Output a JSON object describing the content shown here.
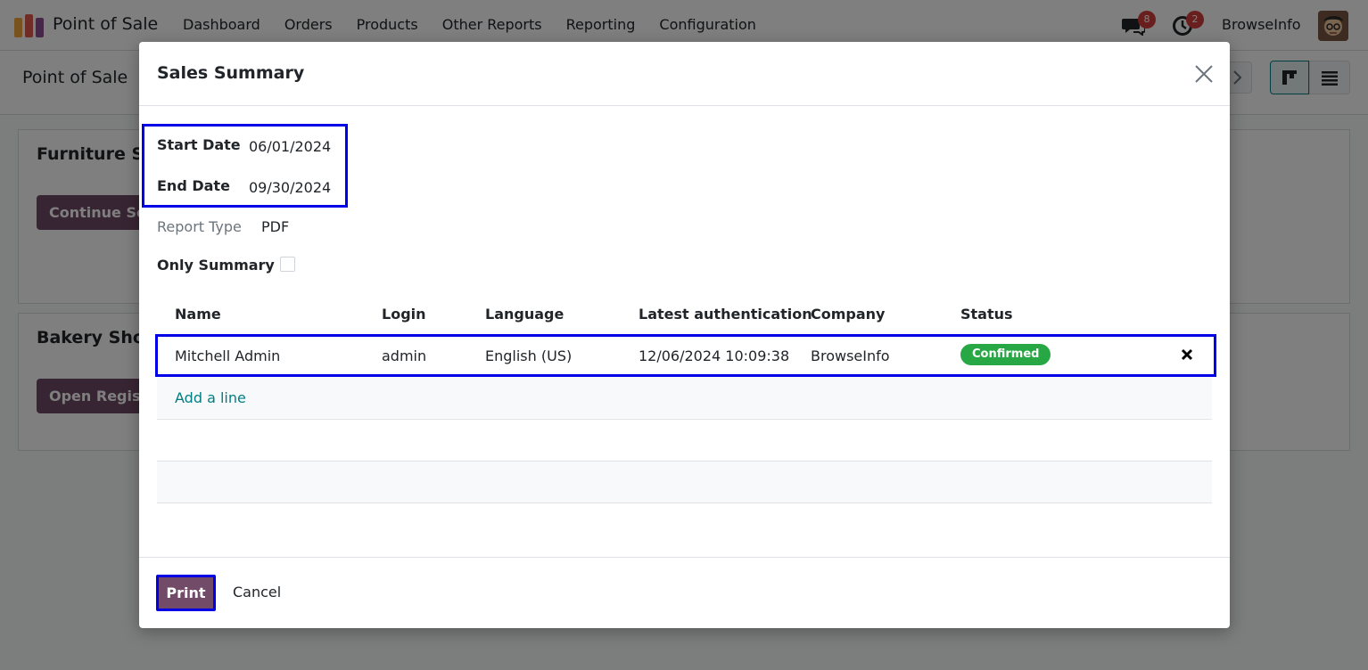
{
  "navbar": {
    "app_name": "Point of Sale",
    "menu": [
      "Dashboard",
      "Orders",
      "Products",
      "Other Reports",
      "Reporting",
      "Configuration"
    ],
    "messages_count": "8",
    "activities_count": "2",
    "user_name": "BrowseInfo"
  },
  "control_panel": {
    "breadcrumb": "Point of Sale"
  },
  "kanban": {
    "cards": [
      {
        "title": "Furniture Sh",
        "button": "Continue Se"
      },
      {
        "title": "Bakery Shop",
        "button": "Open Regist"
      }
    ]
  },
  "modal": {
    "title": "Sales Summary",
    "start_date_label": "Start Date",
    "start_date": "06/01/2024",
    "end_date_label": "End Date",
    "end_date": "09/30/2024",
    "report_type_label": "Report Type",
    "report_type": "PDF",
    "only_summary_label": "Only Summary",
    "only_summary_checked": false,
    "table": {
      "headers": [
        "Name",
        "Login",
        "Language",
        "Latest authentication",
        "Company",
        "Status"
      ],
      "rows": [
        {
          "name": "Mitchell Admin",
          "login": "admin",
          "language": "English (US)",
          "latest_auth": "12/06/2024 10:09:38",
          "company": "BrowseInfo",
          "status": "Confirmed"
        }
      ],
      "add_line": "Add a line"
    },
    "print_label": "Print",
    "cancel_label": "Cancel"
  },
  "colors": {
    "brand": "#714b67",
    "link": "#017e84",
    "status_confirmed": "#28a745",
    "highlight": "#0000e6"
  }
}
